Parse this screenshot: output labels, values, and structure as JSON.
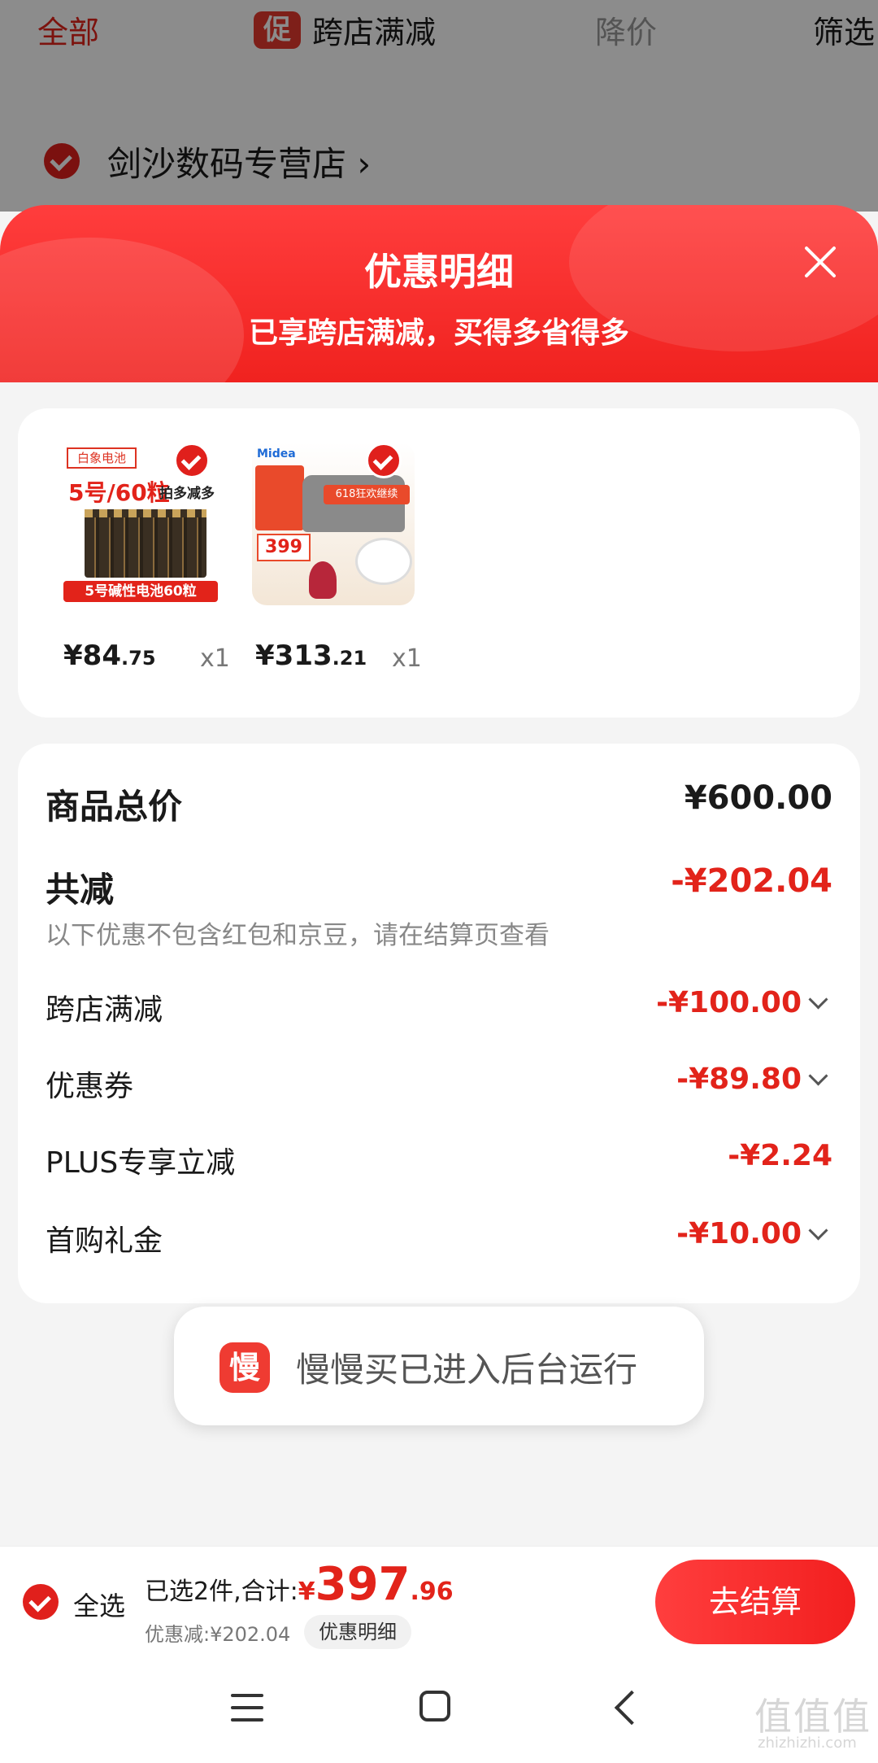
{
  "background": {
    "tabs": [
      {
        "label": "全部"
      },
      {
        "promo_chip": "促",
        "label": "跨店满减"
      },
      {
        "label": "降价"
      },
      {
        "label": "筛选"
      }
    ],
    "store_name": "剑沙数码专营店",
    "store_chevron": "›"
  },
  "sheet": {
    "title": "优惠明细",
    "subtitle": "已享跨店满减，买得多省得多",
    "products": [
      {
        "image_brand": "白象电池",
        "image_headline": "5号/60粒",
        "image_tag": "拍多减多",
        "image_caption": "5号碱性电池60粒",
        "price_symbol": "¥",
        "price_int": "84",
        "price_dec": ".75",
        "qty": "x1"
      },
      {
        "image_brand": "Midea",
        "image_badge": "618狂欢继续",
        "image_price": "399",
        "price_symbol": "¥",
        "price_int": "313",
        "price_dec": ".21",
        "qty": "x1"
      }
    ],
    "summary": {
      "total_label": "商品总价",
      "total_value": "¥600.00",
      "reduce_label": "共减",
      "reduce_value": "-¥202.04",
      "note": "以下优惠不包含红包和京豆，请在结算页查看",
      "rows": [
        {
          "label": "跨店满减",
          "value": "-¥100.00"
        },
        {
          "label": "优惠券",
          "value": "-¥89.80"
        },
        {
          "label": "PLUS专享立减",
          "value": "-¥2.24"
        },
        {
          "label": "首购礼金",
          "value": "-¥10.00"
        }
      ]
    }
  },
  "toast": {
    "icon_char": "慢",
    "text": "慢慢买已进入后台运行"
  },
  "bottom_bar": {
    "select_all": "全选",
    "selected_text": "已选2件,合计:",
    "currency": "¥",
    "total_int": "397",
    "total_dec": ".96",
    "discount_text": "优惠减:¥202.04",
    "detail_chip": "优惠明细",
    "checkout": "去结算"
  },
  "watermark": {
    "logo": "值值值",
    "domain": "zhizhizhi.com"
  },
  "colors": {
    "accent_red": "#e2231a",
    "header_red": "#f0221f"
  }
}
